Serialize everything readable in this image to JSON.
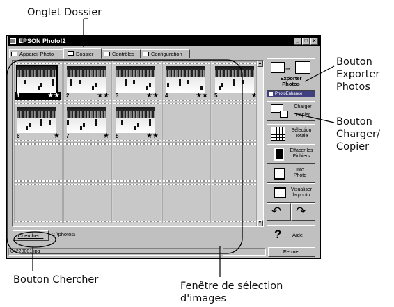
{
  "annotations": {
    "tab_folder": "Onglet Dossier",
    "export_l1": "Bouton",
    "export_l2": "Exporter",
    "export_l3": "Photos",
    "load_l1": "Bouton",
    "load_l2": "Charger/",
    "load_l3": "Copier",
    "search": "Bouton Chercher",
    "window_l1": "Fenêtre de sélection",
    "window_l2": "d'images"
  },
  "window": {
    "title": "EPSON Photo!2",
    "controls": [
      "_",
      "□",
      "×"
    ]
  },
  "tabs": [
    {
      "label": "Appareil Photo",
      "icon": "camera-icon"
    },
    {
      "label": "Dossier",
      "icon": "folder-icon",
      "active": true
    },
    {
      "label": "Contrôles",
      "icon": "controls-icon"
    },
    {
      "label": "Configuration",
      "icon": "config-icon"
    }
  ],
  "thumbnails": [
    {
      "number": "1",
      "stars": "★★",
      "selected": true
    },
    {
      "number": "2",
      "stars": "★★"
    },
    {
      "number": "3",
      "stars": "★★"
    },
    {
      "number": "4",
      "stars": "★★"
    },
    {
      "number": "5",
      "stars": "★"
    },
    {
      "number": "6",
      "stars": "★"
    },
    {
      "number": "7",
      "stars": "★"
    },
    {
      "number": "8",
      "stars": "★★"
    }
  ],
  "sidebar": {
    "export_label_1": "Exporter",
    "export_label_2": "Photos",
    "photo_enhance": "PhotoEnhance",
    "load": "Charger",
    "copy": "Copier",
    "select_all_1": "Sélection",
    "select_all_2": "Totale",
    "delete_1": "Effacer les",
    "delete_2": "Fichiers",
    "info_1": "Info",
    "info_2": "Photo",
    "view_1": "Visualiser",
    "view_2": "la photo",
    "help": "Aide"
  },
  "bottom": {
    "search_button": "Chercher...",
    "path": "C:\\photos\\",
    "status_file": "04220001.jpg",
    "close": "Fermer"
  },
  "colors": {
    "window_bg": "#c0c0c0",
    "titlebar": "#000000"
  }
}
